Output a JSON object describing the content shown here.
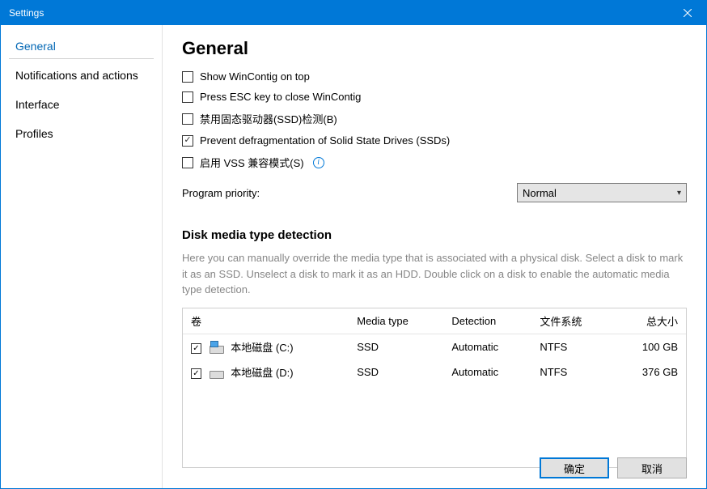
{
  "window": {
    "title": "Settings"
  },
  "sidebar": {
    "items": [
      {
        "label": "General",
        "active": true
      },
      {
        "label": "Notifications and actions",
        "active": false
      },
      {
        "label": "Interface",
        "active": false
      },
      {
        "label": "Profiles",
        "active": false
      }
    ]
  },
  "main": {
    "heading": "General",
    "checkboxes": [
      {
        "label": "Show WinContig on top",
        "checked": false
      },
      {
        "label": "Press ESC key to close WinContig",
        "checked": false
      },
      {
        "label": "禁用固态驱动器(SSD)检测(B)",
        "checked": false
      },
      {
        "label": "Prevent defragmentation of Solid State Drives (SSDs)",
        "checked": true
      },
      {
        "label": "启用 VSS 兼容模式(S)",
        "checked": false,
        "has_info": true
      }
    ],
    "priority": {
      "label": "Program priority:",
      "value": "Normal"
    },
    "disk_section": {
      "heading": "Disk media type detection",
      "desc": "Here you can manually override the media type that is associated with a physical disk. Select a disk to mark it as an SSD. Unselect a disk to mark it as an HDD. Double click on a disk to enable the automatic media type detection.",
      "columns": [
        "卷",
        "Media type",
        "Detection",
        "文件系统",
        "总大小"
      ],
      "rows": [
        {
          "checked": true,
          "icon": "os",
          "name": "本地磁盘 (C:)",
          "media_type": "SSD",
          "detection": "Automatic",
          "fs": "NTFS",
          "size": "100 GB"
        },
        {
          "checked": true,
          "icon": "hdd",
          "name": "本地磁盘 (D:)",
          "media_type": "SSD",
          "detection": "Automatic",
          "fs": "NTFS",
          "size": "376 GB"
        }
      ]
    }
  },
  "footer": {
    "ok": "确定",
    "cancel": "取消"
  }
}
